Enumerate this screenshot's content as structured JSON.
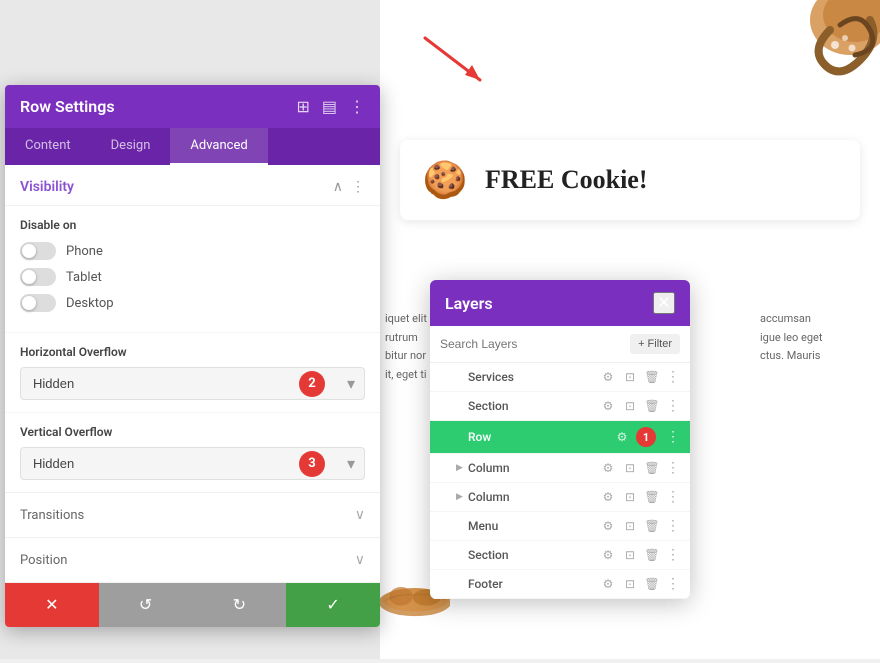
{
  "panel": {
    "title": "Row Settings",
    "tabs": [
      {
        "label": "Content",
        "active": false
      },
      {
        "label": "Design",
        "active": false
      },
      {
        "label": "Advanced",
        "active": true
      }
    ],
    "visibility": {
      "section_title": "Visibility",
      "disable_on_label": "Disable on",
      "phone_label": "Phone",
      "tablet_label": "Tablet",
      "desktop_label": "Desktop"
    },
    "horizontal_overflow": {
      "label": "Horizontal Overflow",
      "value": "Hidden",
      "badge": "2"
    },
    "vertical_overflow": {
      "label": "Vertical Overflow",
      "value": "Hidden",
      "badge": "3"
    },
    "transitions": {
      "label": "Transitions"
    },
    "position": {
      "label": "Position"
    },
    "footer": {
      "cancel_icon": "✕",
      "undo_icon": "↺",
      "redo_icon": "↻",
      "save_icon": "✓"
    }
  },
  "layers": {
    "title": "Layers",
    "search_placeholder": "Search Layers",
    "filter_label": "+ Filter",
    "items": [
      {
        "name": "Services",
        "indent": 0,
        "active": false,
        "has_arrow": false
      },
      {
        "name": "Section",
        "indent": 0,
        "active": false,
        "has_arrow": false
      },
      {
        "name": "Row",
        "indent": 0,
        "active": true,
        "has_arrow": false,
        "badge": "1"
      },
      {
        "name": "Column",
        "indent": 1,
        "active": false,
        "has_arrow": true
      },
      {
        "name": "Column",
        "indent": 1,
        "active": false,
        "has_arrow": true
      },
      {
        "name": "Menu",
        "indent": 0,
        "active": false,
        "has_arrow": false
      },
      {
        "name": "Section",
        "indent": 0,
        "active": false,
        "has_arrow": false
      },
      {
        "name": "Footer",
        "indent": 0,
        "active": false,
        "has_arrow": false
      }
    ]
  },
  "cookie_banner": {
    "icon": "🍪",
    "text": "FREE Cookie!"
  },
  "body_text": {
    "line1": "iquet elit",
    "line2": "rutrum",
    "line3": "bitur nor",
    "line4": "it, eget ti",
    "right1": "accumsan",
    "right2": "igue leo eget",
    "right3": "ctus. Mauris"
  },
  "colors": {
    "purple": "#7b2fbe",
    "green": "#2ecc71",
    "red": "#e53935",
    "dark_purple": "#6a24a8"
  }
}
